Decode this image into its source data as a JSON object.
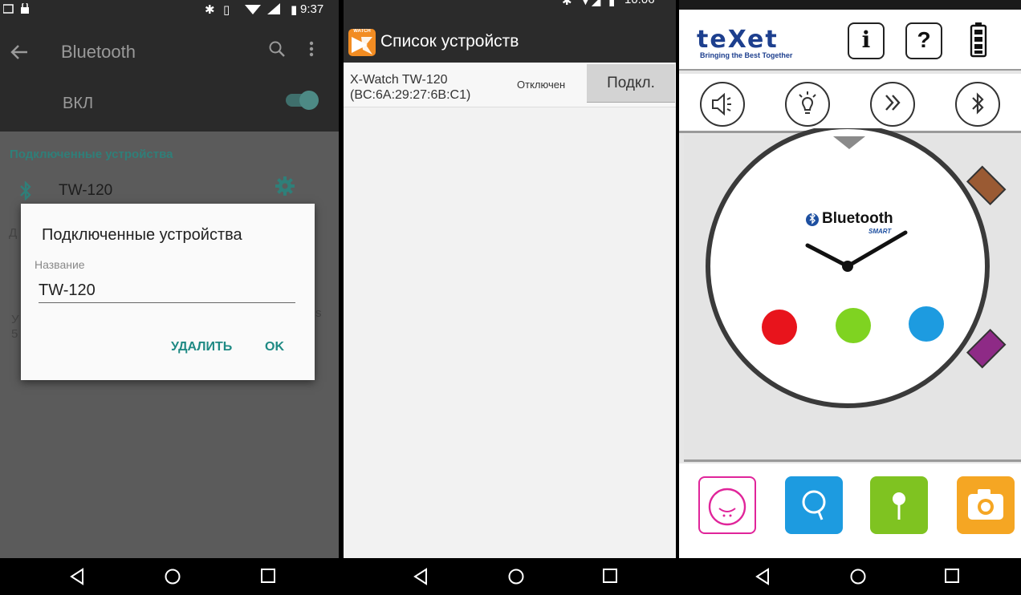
{
  "panel1": {
    "status_time": "9:37",
    "appbar_title": "Bluetooth",
    "switch_label": "ВКЛ",
    "section_title": "Подключенные устройства",
    "device_name": "TW-120",
    "dialog": {
      "title": "Подключенные устройства",
      "label": "Название",
      "value": "TW-120",
      "delete_button": "УДАЛИТЬ",
      "ok_button": "OK"
    },
    "behind_text": {
      "d": "Д",
      "y": "У",
      "five": "5",
      "s": "s"
    }
  },
  "panel2": {
    "status_time": "10:06",
    "logo_text": "WATCH",
    "appbar_title": "Список устройств",
    "device": {
      "name_line1": "X-Watch TW-120",
      "name_line2": "(BC:6A:29:27:6B:C1)",
      "status": "Отключен",
      "button": "Подкл."
    }
  },
  "panel3": {
    "brand": "teXet",
    "tagline": "Bringing the Best Together",
    "watch_text": "Bluetooth",
    "watch_sub": "SMART",
    "colors": {
      "red": "#e8141c",
      "green": "#7fd321",
      "blue": "#1d9be0",
      "brown": "#9a5a33",
      "purple": "#8e2a86"
    }
  }
}
